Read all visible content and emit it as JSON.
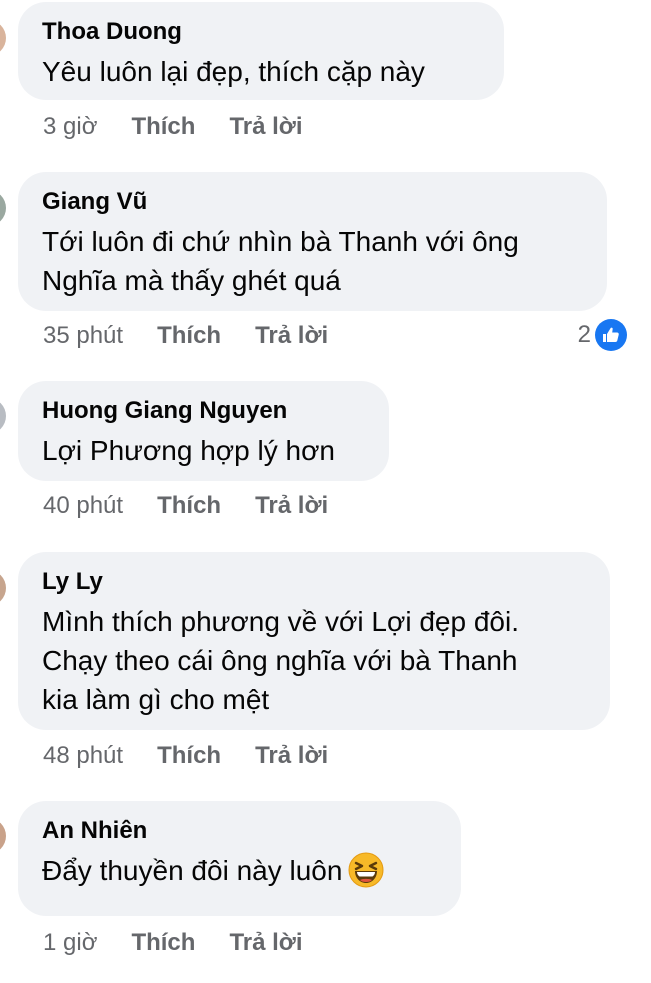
{
  "comments": [
    {
      "author": "Thoa Duong",
      "lines": [
        "Yêu luôn lại đẹp, thích cặp này"
      ],
      "time": "3 giờ",
      "like_label": "Thích",
      "reply_label": "Trả lời"
    },
    {
      "author": "Giang Vũ",
      "lines": [
        "Tới luôn đi chứ nhìn bà Thanh với ông",
        "Nghĩa mà thấy ghét quá"
      ],
      "time": "35 phút",
      "like_label": "Thích",
      "reply_label": "Trả lời",
      "reaction_count": "2"
    },
    {
      "author": "Huong Giang Nguyen",
      "lines": [
        "Lợi Phương hợp lý hơn"
      ],
      "time": "40 phút",
      "like_label": "Thích",
      "reply_label": "Trả lời"
    },
    {
      "author": "Ly Ly",
      "lines": [
        "Mình thích phương về với Lợi đẹp đôi.",
        "Chạy theo cái ông nghĩa với bà Thanh",
        "kia làm gì cho mệt"
      ],
      "time": "48 phút",
      "like_label": "Thích",
      "reply_label": "Trả lời"
    },
    {
      "author": "An Nhiên",
      "lines": [
        "Đẩy thuyền đôi này luôn"
      ],
      "time": "1 giờ",
      "like_label": "Thích",
      "reply_label": "Trả lời",
      "emoji": "grinning-squinting-face-emoji"
    }
  ],
  "colors": {
    "bubble": "#f0f2f5",
    "meta": "#65676b",
    "like_blue": "#1877f2"
  }
}
